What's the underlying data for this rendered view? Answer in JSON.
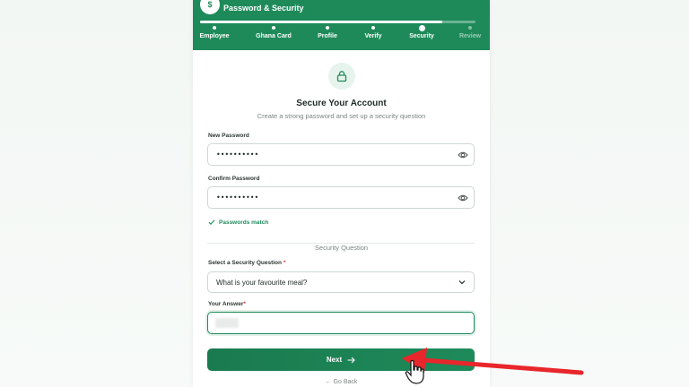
{
  "header": {
    "badge": "$",
    "title": "Password & Security",
    "progress": 0.88,
    "steps": [
      {
        "label": "Employee",
        "state": "done"
      },
      {
        "label": "Ghana Card",
        "state": "done"
      },
      {
        "label": "Profile",
        "state": "done"
      },
      {
        "label": "Verify",
        "state": "done"
      },
      {
        "label": "Security",
        "state": "current"
      },
      {
        "label": "Review",
        "state": "future"
      }
    ]
  },
  "intro": {
    "icon": "lock-icon",
    "title": "Secure Your Account",
    "subtitle": "Create a strong password and set up a security question"
  },
  "new_password": {
    "label": "New Password",
    "value": "••••••••••"
  },
  "confirm_password": {
    "label": "Confirm Password",
    "value": "••••••••••"
  },
  "match_message": "Passwords match",
  "security": {
    "section_title": "Security Question",
    "question_label": "Select a Security Question",
    "required_mark": "*",
    "selected_question": "What is your favourite meal?",
    "answer_label": "Your Answer",
    "answer_required_mark": "*"
  },
  "actions": {
    "next_label": "Next",
    "back_label": "Go Back"
  },
  "colors": {
    "brand": "#1e8a5a",
    "annotation_arrow": "#e8262b"
  }
}
